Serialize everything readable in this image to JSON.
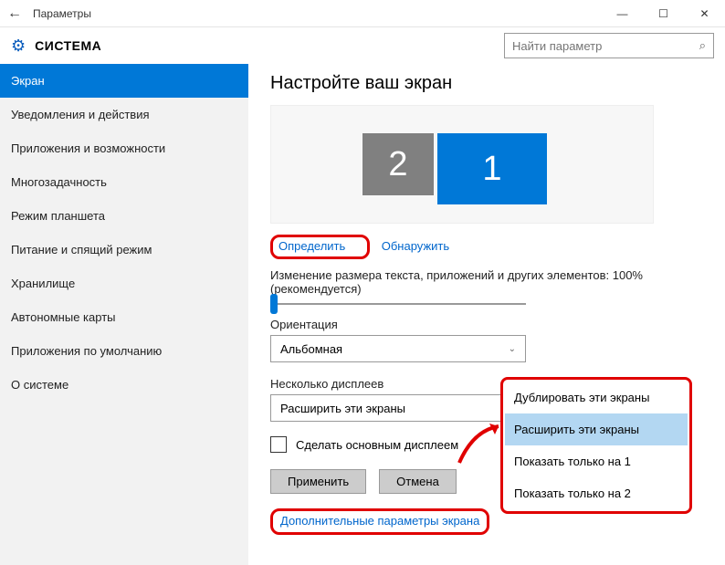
{
  "titlebar": {
    "title": "Параметры"
  },
  "header": {
    "section": "СИСТЕМА",
    "search_placeholder": "Найти параметр"
  },
  "sidebar": {
    "items": [
      {
        "label": "Экран",
        "active": true
      },
      {
        "label": "Уведомления и действия"
      },
      {
        "label": "Приложения и возможности"
      },
      {
        "label": "Многозадачность"
      },
      {
        "label": "Режим планшета"
      },
      {
        "label": "Питание и спящий режим"
      },
      {
        "label": "Хранилище"
      },
      {
        "label": "Автономные карты"
      },
      {
        "label": "Приложения по умолчанию"
      },
      {
        "label": "О системе"
      }
    ]
  },
  "main": {
    "heading": "Настройте ваш экран",
    "monitors": {
      "m2": "2",
      "m1": "1"
    },
    "links": {
      "identify": "Определить",
      "detect": "Обнаружить"
    },
    "scale_label": "Изменение размера текста, приложений и других элементов: 100% (рекомендуется)",
    "orientation_label": "Ориентация",
    "orientation_value": "Альбомная",
    "multidisplay_label": "Несколько дисплеев",
    "multidisplay_value": "Расширить эти экраны",
    "make_main": "Сделать основным дисплеем",
    "apply": "Применить",
    "cancel": "Отмена",
    "advanced": "Дополнительные параметры экрана"
  },
  "dropdown": {
    "options": [
      "Дублировать эти экраны",
      "Расширить эти экраны",
      "Показать только на 1",
      "Показать только на 2"
    ],
    "selected_index": 1
  }
}
